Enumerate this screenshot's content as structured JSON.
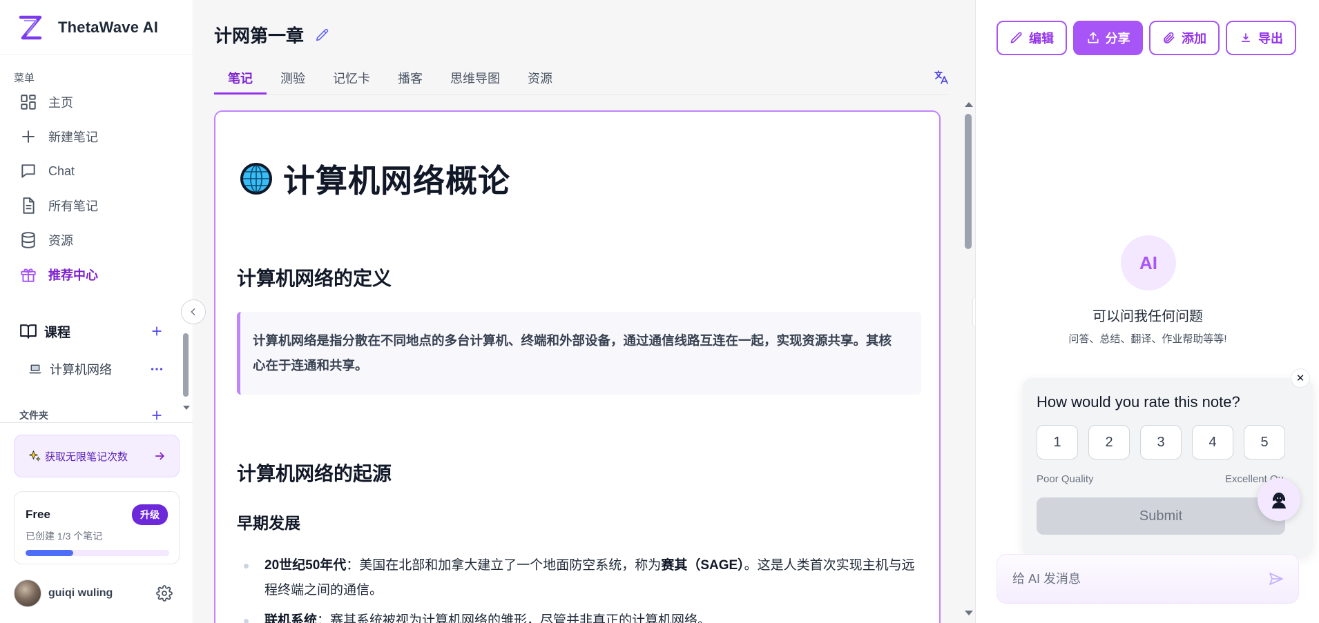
{
  "brand": {
    "name": "ThetaWave AI"
  },
  "sidebar": {
    "menu_heading": "菜单",
    "items": [
      {
        "label": "主页",
        "icon": "grid-icon"
      },
      {
        "label": "新建笔记",
        "icon": "plus-icon"
      },
      {
        "label": "Chat",
        "icon": "chat-icon"
      },
      {
        "label": "所有笔记",
        "icon": "document-icon"
      },
      {
        "label": "资源",
        "icon": "database-icon"
      },
      {
        "label": "推荐中心",
        "icon": "gift-icon",
        "active": true
      }
    ],
    "courses_label": "课程",
    "course_items": [
      {
        "label": "计算机网络",
        "icon": "laptop-icon"
      }
    ],
    "folders_label": "文件夹",
    "promo_text": "获取无限笔记次数",
    "plan": {
      "name": "Free",
      "upgrade_label": "升级",
      "usage_text": "已创建 1/3 个笔记",
      "usage_fraction": 0.333
    },
    "user": {
      "name": "guiqi wuling"
    }
  },
  "main": {
    "title": "计网第一章",
    "tabs": [
      {
        "label": "笔记",
        "active": true
      },
      {
        "label": "测验"
      },
      {
        "label": "记忆卡"
      },
      {
        "label": "播客"
      },
      {
        "label": "思维导图"
      },
      {
        "label": "资源"
      }
    ]
  },
  "note": {
    "h1": "计算机网络概论",
    "h2_definition": "计算机网络的定义",
    "callout": "计算机网络是指分散在不同地点的多台计算机、终端和外部设备，通过通信线路互连在一起，实现资源共享。其核心在于连通和共享。",
    "h2_origin": "计算机网络的起源",
    "h3_early": "早期发展",
    "bullets": [
      {
        "term": "20世纪50年代",
        "sep": "：",
        "text_before": "美国在北部和加拿大建立了一个地面防空系统，称为",
        "bold_mid": "赛其（SAGE）",
        "text_after": "。这是人类首次实现主机与远程终端之间的通信。"
      },
      {
        "term": "联机系统",
        "sep": "：",
        "text": "赛其系统被视为计算机网络的雏形，尽管并非真正的计算机网络。"
      }
    ]
  },
  "right_panel": {
    "actions": [
      {
        "label": "编辑",
        "icon": "pencil-icon"
      },
      {
        "label": "分享",
        "icon": "share-icon",
        "primary": true
      },
      {
        "label": "添加",
        "icon": "paperclip-icon"
      },
      {
        "label": "导出",
        "icon": "download-icon"
      }
    ],
    "ai_badge": "AI",
    "ai_title": "可以问我任何问题",
    "ai_subtitle": "问答、总结、翻译、作业帮助等等!",
    "rating": {
      "title": "How would you rate this note?",
      "options": [
        "1",
        "2",
        "3",
        "4",
        "5"
      ],
      "low_label": "Poor Quality",
      "high_label": "Excellent Qu",
      "submit_label": "Submit",
      "close_label": "✕"
    },
    "chat_placeholder": "给 AI 发消息"
  },
  "colors": {
    "accent": "#a855f7",
    "accent_dark": "#7e22ce",
    "progress": "#4f6ef7",
    "upgrade": "#6d28d9"
  }
}
